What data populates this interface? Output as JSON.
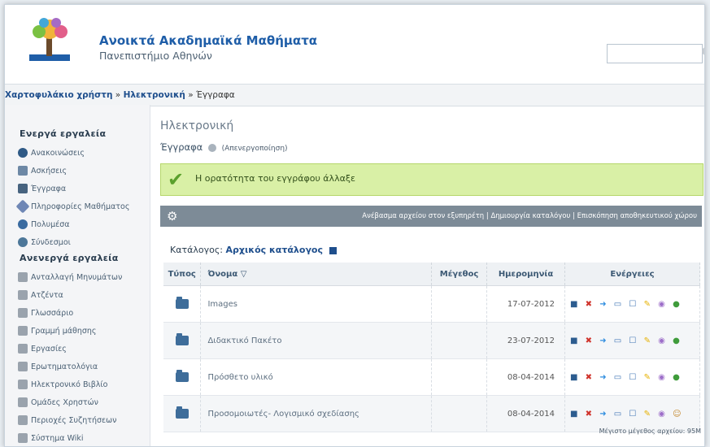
{
  "header": {
    "title": "Ανοικτά Ακαδημαϊκά Μαθήματα",
    "subtitle": "Πανεπιστήμιο Αθηνών",
    "search": {
      "placeholder": ""
    }
  },
  "breadcrumb": {
    "part1": "Χαρτοφυλάκιο χρήστη",
    "sep1": " » ",
    "part2": "Ηλεκτρονική",
    "sep2": " » ",
    "part3": "Έγγραφα"
  },
  "sidebar": {
    "active_header": "Ενεργά εργαλεία",
    "active_items": [
      {
        "label": "Ανακοινώσεις",
        "icon": "announcements-icon",
        "color": "#2f5a86"
      },
      {
        "label": "Ασκήσεις",
        "icon": "exercises-icon",
        "color": "#6d88a5"
      },
      {
        "label": "Έγγραφα",
        "icon": "documents-icon",
        "color": "#47637f"
      },
      {
        "label": "Πληροφορίες Μαθήματος",
        "icon": "info-icon",
        "color": "#6f87b5"
      },
      {
        "label": "Πολυμέσα",
        "icon": "multimedia-icon",
        "color": "#3a6ba0"
      },
      {
        "label": "Σύνδεσμοι",
        "icon": "links-icon",
        "color": "#4d7799"
      }
    ],
    "inactive_header": "Ανενεργά εργαλεία",
    "inactive_items": [
      {
        "label": "Ανταλλαγή Μηνυμάτων",
        "icon": "messages-icon",
        "color": "#9aa3ad"
      },
      {
        "label": "Ατζέντα",
        "icon": "agenda-icon",
        "color": "#9aa3ad"
      },
      {
        "label": "Γλωσσάριο",
        "icon": "glossary-icon",
        "color": "#9aa3ad"
      },
      {
        "label": "Γραμμή μάθησης",
        "icon": "learning-path-icon",
        "color": "#9aa3ad"
      },
      {
        "label": "Εργασίες",
        "icon": "assignments-icon",
        "color": "#9aa3ad"
      },
      {
        "label": "Ερωτηματολόγια",
        "icon": "questionnaires-icon",
        "color": "#9aa3ad"
      },
      {
        "label": "Ηλεκτρονικό Βιβλίο",
        "icon": "ebook-icon",
        "color": "#9aa3ad"
      },
      {
        "label": "Ομάδες Χρηστών",
        "icon": "user-groups-icon",
        "color": "#9aa3ad"
      },
      {
        "label": "Περιοχές Συζητήσεων",
        "icon": "forums-icon",
        "color": "#9aa3ad"
      },
      {
        "label": "Σύστημα Wiki",
        "icon": "wiki-icon",
        "color": "#9aa3ad"
      }
    ]
  },
  "main": {
    "title": "Ηλεκτρονική",
    "section": "Έγγραφα",
    "deactivate": "(Απενεργοποίηση)",
    "message": "Η ορατότητα του εγγράφου άλλαξε",
    "toolbar": {
      "upload": "Ανέβασμα αρχείου στον εξυπηρέτη",
      "sep": " | ",
      "create_dir": "Δημιουργία καταλόγου",
      "quota": "Επισκόπηση αποθηκευτικού χώρου"
    },
    "catalog_label": "Κατάλογος:",
    "catalog_value": "Αρχικός κατάλογος",
    "table": {
      "headers": [
        "Τύπος",
        "Όνομα",
        "Μέγεθος",
        "Ημερομηνία",
        "Ενέργειες"
      ],
      "sort_glyph": "▽",
      "rows": [
        {
          "name": "Images",
          "size": "",
          "date": "17-07-2012"
        },
        {
          "name": "Διδακτικό Πακέτο",
          "size": "",
          "date": "23-07-2012"
        },
        {
          "name": "Πρόσθετο υλικό",
          "size": "",
          "date": "08-04-2014"
        },
        {
          "name": "Προσομοιωτές- Λογισμικό σχεδίασης",
          "size": "",
          "date": "08-04-2014"
        }
      ]
    },
    "footer": "Μέγιστο μέγεθος αρχείου: 95M"
  },
  "colors": {
    "brand": "#1f5ea8",
    "message_bg": "#d9f0a6",
    "toolbar_bg": "#7d8b97"
  }
}
